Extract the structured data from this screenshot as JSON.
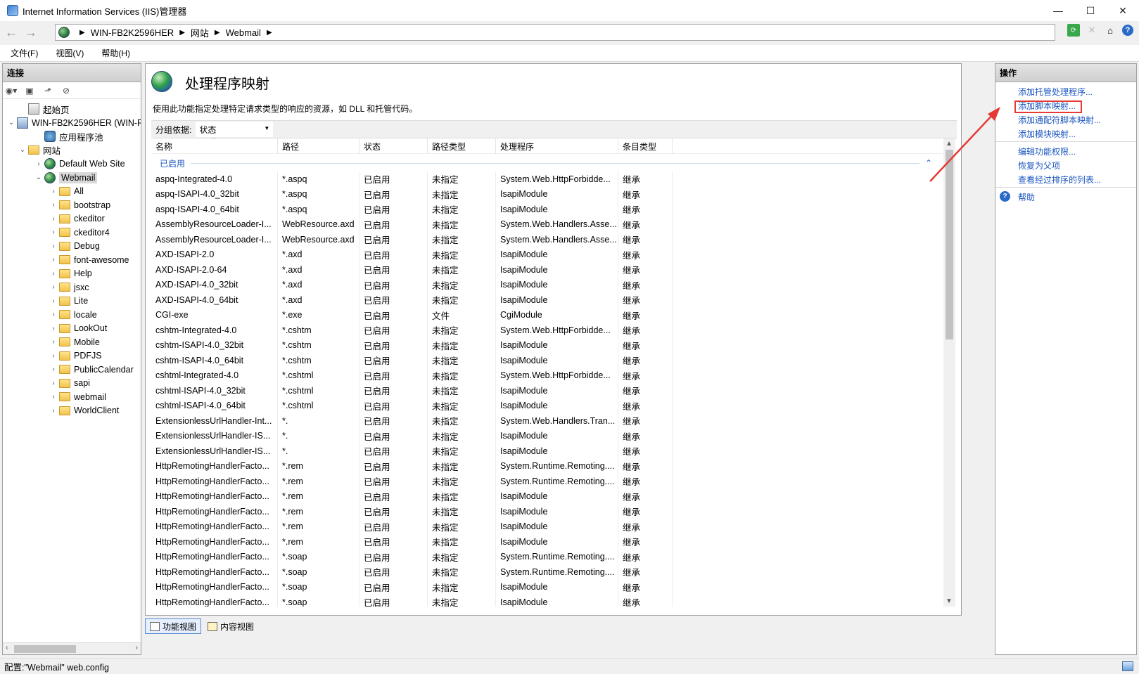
{
  "window": {
    "title": "Internet Information Services (IIS)管理器",
    "controls": {
      "minimize": "—",
      "maximize": "☐",
      "close": "✕"
    }
  },
  "address": {
    "crumbs": [
      "WIN-FB2K2596HER",
      "网站",
      "Webmail"
    ],
    "sep": "▶",
    "back": "←",
    "forward": "→"
  },
  "menu": [
    "文件(F)",
    "视图(V)",
    "帮助(H)"
  ],
  "connections": {
    "header": "连接",
    "tree": [
      {
        "label": "起始页",
        "level": 1,
        "icon": "start",
        "chev": ""
      },
      {
        "label": "WIN-FB2K2596HER (WIN-F",
        "level": 0,
        "icon": "server",
        "chev": "⌄"
      },
      {
        "label": "应用程序池",
        "level": 2,
        "icon": "pool",
        "chev": ""
      },
      {
        "label": "网站",
        "level": 1,
        "icon": "folder",
        "chev": "⌄"
      },
      {
        "label": "Default Web Site",
        "level": 2,
        "icon": "globe",
        "chev": "›"
      },
      {
        "label": "Webmail",
        "level": 2,
        "icon": "globe",
        "chev": "⌄",
        "selected": true
      },
      {
        "label": "All",
        "level": 3,
        "icon": "folder",
        "chev": "›"
      },
      {
        "label": "bootstrap",
        "level": 3,
        "icon": "folder",
        "chev": "›"
      },
      {
        "label": "ckeditor",
        "level": 3,
        "icon": "folder",
        "chev": "›"
      },
      {
        "label": "ckeditor4",
        "level": 3,
        "icon": "folder",
        "chev": "›"
      },
      {
        "label": "Debug",
        "level": 3,
        "icon": "folder",
        "chev": "›"
      },
      {
        "label": "font-awesome",
        "level": 3,
        "icon": "folder",
        "chev": "›"
      },
      {
        "label": "Help",
        "level": 3,
        "icon": "folder",
        "chev": "›"
      },
      {
        "label": "jsxc",
        "level": 3,
        "icon": "folder",
        "chev": "›"
      },
      {
        "label": "Lite",
        "level": 3,
        "icon": "folder",
        "chev": "›"
      },
      {
        "label": "locale",
        "level": 3,
        "icon": "folder",
        "chev": "›"
      },
      {
        "label": "LookOut",
        "level": 3,
        "icon": "folder",
        "chev": "›"
      },
      {
        "label": "Mobile",
        "level": 3,
        "icon": "folder",
        "chev": "›"
      },
      {
        "label": "PDFJS",
        "level": 3,
        "icon": "folder",
        "chev": "›"
      },
      {
        "label": "PublicCalendar",
        "level": 3,
        "icon": "folder",
        "chev": "›"
      },
      {
        "label": "sapi",
        "level": 3,
        "icon": "folder",
        "chev": "›"
      },
      {
        "label": "webmail",
        "level": 3,
        "icon": "folder",
        "chev": "›"
      },
      {
        "label": "WorldClient",
        "level": 3,
        "icon": "folder",
        "chev": "›"
      }
    ]
  },
  "feature": {
    "title": "处理程序映射",
    "description": "使用此功能指定处理特定请求类型的响应的资源，如 DLL 和托管代码。",
    "group_by_label": "分组依据:",
    "group_by_value": "状态",
    "group_name": "已启用",
    "columns": [
      "名称",
      "路径",
      "状态",
      "路径类型",
      "处理程序",
      "条目类型"
    ],
    "rows": [
      [
        "aspq-Integrated-4.0",
        "*.aspq",
        "已启用",
        "未指定",
        "System.Web.HttpForbidde...",
        "继承"
      ],
      [
        "aspq-ISAPI-4.0_32bit",
        "*.aspq",
        "已启用",
        "未指定",
        "IsapiModule",
        "继承"
      ],
      [
        "aspq-ISAPI-4.0_64bit",
        "*.aspq",
        "已启用",
        "未指定",
        "IsapiModule",
        "继承"
      ],
      [
        "AssemblyResourceLoader-I...",
        "WebResource.axd",
        "已启用",
        "未指定",
        "System.Web.Handlers.Asse...",
        "继承"
      ],
      [
        "AssemblyResourceLoader-I...",
        "WebResource.axd",
        "已启用",
        "未指定",
        "System.Web.Handlers.Asse...",
        "继承"
      ],
      [
        "AXD-ISAPI-2.0",
        "*.axd",
        "已启用",
        "未指定",
        "IsapiModule",
        "继承"
      ],
      [
        "AXD-ISAPI-2.0-64",
        "*.axd",
        "已启用",
        "未指定",
        "IsapiModule",
        "继承"
      ],
      [
        "AXD-ISAPI-4.0_32bit",
        "*.axd",
        "已启用",
        "未指定",
        "IsapiModule",
        "继承"
      ],
      [
        "AXD-ISAPI-4.0_64bit",
        "*.axd",
        "已启用",
        "未指定",
        "IsapiModule",
        "继承"
      ],
      [
        "CGI-exe",
        "*.exe",
        "已启用",
        "文件",
        "CgiModule",
        "继承"
      ],
      [
        "cshtm-Integrated-4.0",
        "*.cshtm",
        "已启用",
        "未指定",
        "System.Web.HttpForbidde...",
        "继承"
      ],
      [
        "cshtm-ISAPI-4.0_32bit",
        "*.cshtm",
        "已启用",
        "未指定",
        "IsapiModule",
        "继承"
      ],
      [
        "cshtm-ISAPI-4.0_64bit",
        "*.cshtm",
        "已启用",
        "未指定",
        "IsapiModule",
        "继承"
      ],
      [
        "cshtml-Integrated-4.0",
        "*.cshtml",
        "已启用",
        "未指定",
        "System.Web.HttpForbidde...",
        "继承"
      ],
      [
        "cshtml-ISAPI-4.0_32bit",
        "*.cshtml",
        "已启用",
        "未指定",
        "IsapiModule",
        "继承"
      ],
      [
        "cshtml-ISAPI-4.0_64bit",
        "*.cshtml",
        "已启用",
        "未指定",
        "IsapiModule",
        "继承"
      ],
      [
        "ExtensionlessUrlHandler-Int...",
        "*.",
        "已启用",
        "未指定",
        "System.Web.Handlers.Tran...",
        "继承"
      ],
      [
        "ExtensionlessUrlHandler-IS...",
        "*.",
        "已启用",
        "未指定",
        "IsapiModule",
        "继承"
      ],
      [
        "ExtensionlessUrlHandler-IS...",
        "*.",
        "已启用",
        "未指定",
        "IsapiModule",
        "继承"
      ],
      [
        "HttpRemotingHandlerFacto...",
        "*.rem",
        "已启用",
        "未指定",
        "System.Runtime.Remoting....",
        "继承"
      ],
      [
        "HttpRemotingHandlerFacto...",
        "*.rem",
        "已启用",
        "未指定",
        "System.Runtime.Remoting....",
        "继承"
      ],
      [
        "HttpRemotingHandlerFacto...",
        "*.rem",
        "已启用",
        "未指定",
        "IsapiModule",
        "继承"
      ],
      [
        "HttpRemotingHandlerFacto...",
        "*.rem",
        "已启用",
        "未指定",
        "IsapiModule",
        "继承"
      ],
      [
        "HttpRemotingHandlerFacto...",
        "*.rem",
        "已启用",
        "未指定",
        "IsapiModule",
        "继承"
      ],
      [
        "HttpRemotingHandlerFacto...",
        "*.rem",
        "已启用",
        "未指定",
        "IsapiModule",
        "继承"
      ],
      [
        "HttpRemotingHandlerFacto...",
        "*.soap",
        "已启用",
        "未指定",
        "System.Runtime.Remoting....",
        "继承"
      ],
      [
        "HttpRemotingHandlerFacto...",
        "*.soap",
        "已启用",
        "未指定",
        "System.Runtime.Remoting....",
        "继承"
      ],
      [
        "HttpRemotingHandlerFacto...",
        "*.soap",
        "已启用",
        "未指定",
        "IsapiModule",
        "继承"
      ],
      [
        "HttpRemotingHandlerFacto...",
        "*.soap",
        "已启用",
        "未指定",
        "IsapiModule",
        "继承"
      ]
    ]
  },
  "view_tabs": {
    "features": "功能视图",
    "content": "内容视图"
  },
  "actions": {
    "header": "操作",
    "group1": [
      "添加托管处理程序...",
      "添加脚本映射...",
      "添加通配符脚本映射...",
      "添加模块映射..."
    ],
    "group2": [
      "编辑功能权限...",
      "恢复为父项",
      "查看经过排序的列表..."
    ],
    "help": "帮助"
  },
  "status": {
    "text": "配置:\"Webmail\" web.config"
  },
  "colors": {
    "link": "#1a56c0",
    "annotation": "#e53935"
  }
}
